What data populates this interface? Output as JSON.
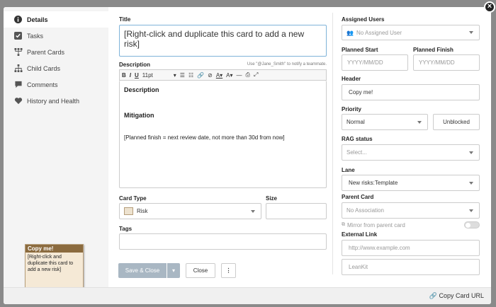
{
  "sidebar": {
    "items": [
      {
        "label": "Details",
        "icon": "info-icon",
        "active": true
      },
      {
        "label": "Tasks",
        "icon": "checkbox-icon"
      },
      {
        "label": "Parent Cards",
        "icon": "parent-cards-icon"
      },
      {
        "label": "Child Cards",
        "icon": "child-cards-icon"
      },
      {
        "label": "Comments",
        "icon": "comment-icon"
      },
      {
        "label": "History and Health",
        "icon": "heart-icon"
      }
    ]
  },
  "card_preview": {
    "title": "Copy me!",
    "body": "[Right-click and duplicate this card to add a new risk]"
  },
  "form": {
    "title_label": "Title",
    "title_value": "[Right-click and duplicate this card to add a new risk]",
    "description_label": "Description",
    "mention_hint": "Use \"@Jane_Smith\" to notify a teammate.",
    "toolbar": {
      "font_size": "11pt"
    },
    "description_heading1": "Description",
    "description_heading2": "Mitigation",
    "description_text": "[Planned finish = next review date, not more than 30d from now]",
    "card_type_label": "Card Type",
    "card_type_value": "Risk",
    "size_label": "Size",
    "tags_label": "Tags",
    "save_close_label": "Save & Close",
    "close_label": "Close"
  },
  "right": {
    "assigned_users_label": "Assigned Users",
    "assigned_users_value": "No Assigned User",
    "planned_start_label": "Planned Start",
    "planned_start_placeholder": "YYYY/MM/DD",
    "planned_finish_label": "Planned Finish",
    "planned_finish_placeholder": "YYYY/MM/DD",
    "header_label": "Header",
    "header_value": "Copy me!",
    "priority_label": "Priority",
    "priority_value": "Normal",
    "unblocked_label": "Unblocked",
    "rag_label": "RAG status",
    "rag_placeholder": "Select...",
    "lane_label": "Lane",
    "lane_value": "New risks:Template",
    "parent_card_label": "Parent Card",
    "parent_card_value": "No Association",
    "mirror_label": "Mirror from parent card",
    "external_link_label": "External Link",
    "external_link_placeholder": "http://www.example.com",
    "external_link_title_placeholder": "LeanKit"
  },
  "footer": {
    "copy_url_label": "Copy Card URL"
  }
}
